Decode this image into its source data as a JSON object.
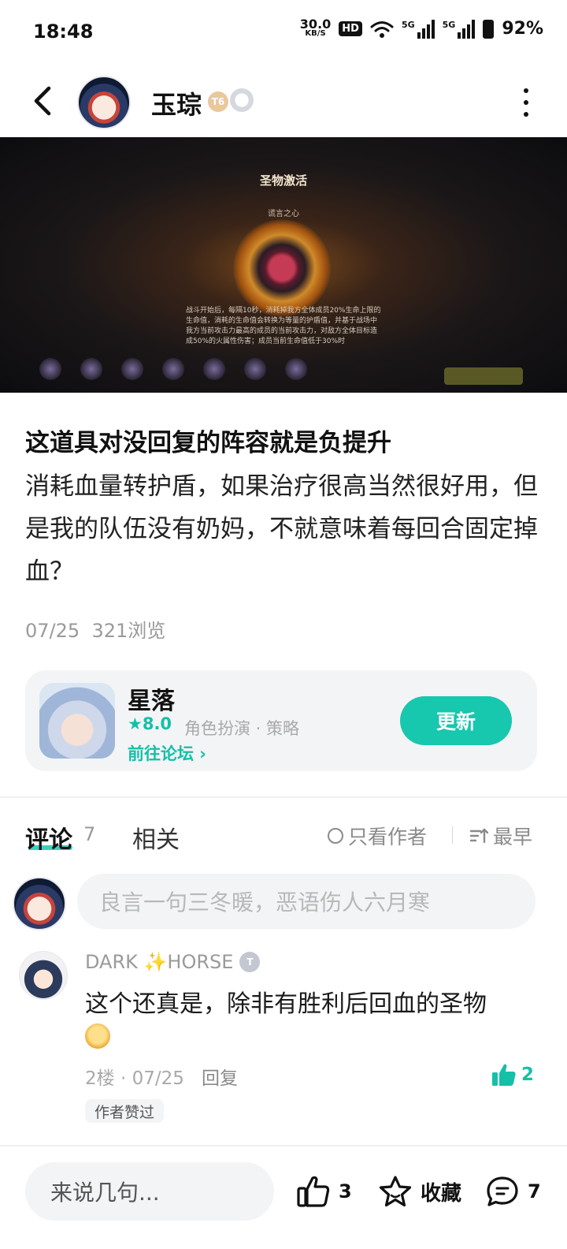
{
  "status": {
    "time": "18:48",
    "net_speed": "30.0",
    "net_unit": "KB/S",
    "hd": "HD",
    "signal1_label": "5G",
    "signal2_label": "5G",
    "battery": "92%"
  },
  "header": {
    "username": "玉琮",
    "level_badge": "T6",
    "icons": [
      "back-arrow-icon",
      "more-vertical-icon"
    ]
  },
  "banner": {
    "title": "圣物激活",
    "subtitle": "谎言之心",
    "description": "战斗开始后，每隔10秒，消耗掉我方全体成员20%生命上限的生命值，消耗的生命值会转换为等量的护盾值，并基于战场中我方当前攻击力最高的成员的当前攻击力，对敌方全体目标造成50%的火属性伤害；成员当前生命值低于30%时"
  },
  "post": {
    "title": "这道具对没回复的阵容就是负提升",
    "body": "消耗血量转护盾，如果治疗很高当然很好用，但是我的队伍没有奶妈，不就意味着每回合固定掉血？",
    "date": "07/25",
    "views": "321浏览"
  },
  "game": {
    "name": "星落",
    "rating": "★8.0",
    "tags": "角色扮演 · 策略",
    "forum_link": "前往论坛 ›",
    "action_label": "更新",
    "accent_color": "#17c7ae"
  },
  "tabs": {
    "comments_label": "评论",
    "comments_count": "7",
    "related_label": "相关",
    "author_only_label": "只看作者",
    "sort_label": "最早"
  },
  "composer": {
    "placeholder": "良言一句三冬暖，恶语伤人六月寒"
  },
  "comments": [
    {
      "username": "DARK ✨HORSE",
      "badge": "T",
      "text": "这个还真是，除非有胜利后回血的圣物",
      "meta": "2楼 · 07/25",
      "reply_label": "回复",
      "likes": "2",
      "tag": "作者赞过"
    }
  ],
  "bottom_bar": {
    "input_placeholder": "来说几句...",
    "like_count": "3",
    "favorite_label": "收藏",
    "comment_count": "7"
  }
}
